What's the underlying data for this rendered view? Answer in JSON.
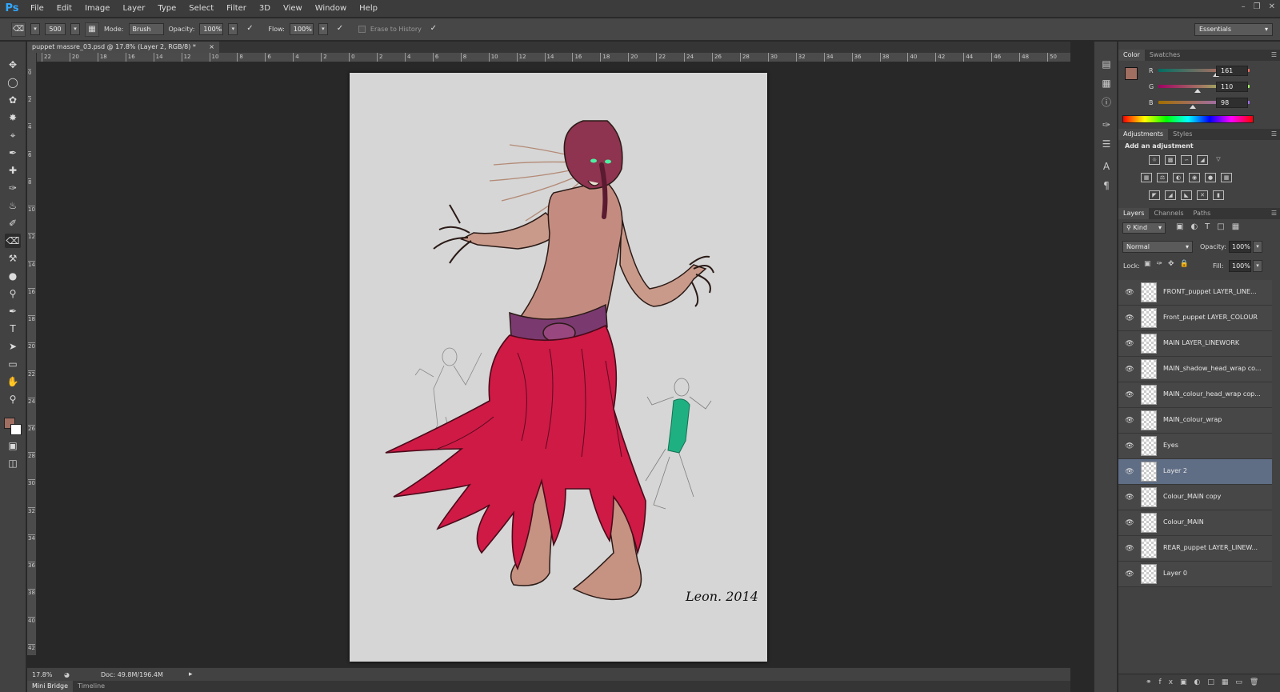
{
  "app": {
    "logo": "Ps",
    "menu": [
      "File",
      "Edit",
      "Image",
      "Layer",
      "Type",
      "Select",
      "Filter",
      "3D",
      "View",
      "Window",
      "Help"
    ],
    "window_controls": [
      "–",
      "❐",
      "✕"
    ]
  },
  "options_bar": {
    "brush_size": "500",
    "mode_label": "Mode:",
    "mode_value": "Brush",
    "opacity_label": "Opacity:",
    "opacity_value": "100%",
    "flow_label": "Flow:",
    "flow_value": "100%",
    "erase_history_label": "Erase to History",
    "workspace": "Essentials"
  },
  "document": {
    "tab_title": "puppet massre_03.psd @ 17.8% (Layer 2, RGB/8) *",
    "tab_close": "×",
    "ruler_h": [
      "22",
      "20",
      "18",
      "16",
      "14",
      "12",
      "10",
      "8",
      "6",
      "4",
      "2",
      "0",
      "2",
      "4",
      "6",
      "8",
      "10",
      "12",
      "14",
      "16",
      "18",
      "20",
      "22",
      "24",
      "26",
      "28",
      "30",
      "32",
      "34",
      "36",
      "38",
      "40",
      "42",
      "44",
      "46",
      "48",
      "50"
    ],
    "ruler_v": [
      "0",
      "2",
      "4",
      "6",
      "8",
      "10",
      "12",
      "14",
      "16",
      "18",
      "20",
      "22",
      "24",
      "26",
      "28",
      "30",
      "32",
      "34",
      "36",
      "38",
      "40",
      "42"
    ],
    "signature": "Leon. 2014"
  },
  "status": {
    "zoom": "17.8%",
    "doc_size": "Doc: 49.8M/196.4M"
  },
  "bottom_tabs": [
    "Mini Bridge",
    "Timeline"
  ],
  "color_panel": {
    "tabs": [
      "Color",
      "Swatches"
    ],
    "r_label": "R",
    "r_value": "161",
    "r_level": 0.63,
    "g_label": "G",
    "g_value": "110",
    "g_level": 0.43,
    "b_label": "B",
    "b_value": "98",
    "b_level": 0.38,
    "foreground": "#a16e62",
    "background": "#ffffff"
  },
  "adjustments_panel": {
    "tabs": [
      "Adjustments",
      "Styles"
    ],
    "heading": "Add an adjustment"
  },
  "layers_panel": {
    "tabs": [
      "Layers",
      "Channels",
      "Paths"
    ],
    "filter_label": "Kind",
    "blend_mode": "Normal",
    "opacity_label": "Opacity:",
    "opacity_value": "100%",
    "lock_label": "Lock:",
    "fill_label": "Fill:",
    "fill_value": "100%",
    "layers": [
      {
        "name": "FRONT_puppet LAYER_LINE..."
      },
      {
        "name": "Front_puppet LAYER_COLOUR"
      },
      {
        "name": "MAIN LAYER_LINEWORK"
      },
      {
        "name": "MAIN_shadow_head_wrap co..."
      },
      {
        "name": "MAIN_colour_head_wrap cop..."
      },
      {
        "name": "MAIN_colour_wrap"
      },
      {
        "name": "Eyes"
      },
      {
        "name": "Layer 2"
      },
      {
        "name": "Colour_MAIN copy"
      },
      {
        "name": "Colour_MAIN"
      },
      {
        "name": "REAR_puppet LAYER_LINEW..."
      },
      {
        "name": "Layer 0"
      }
    ],
    "selected_layer": "Layer 2"
  }
}
